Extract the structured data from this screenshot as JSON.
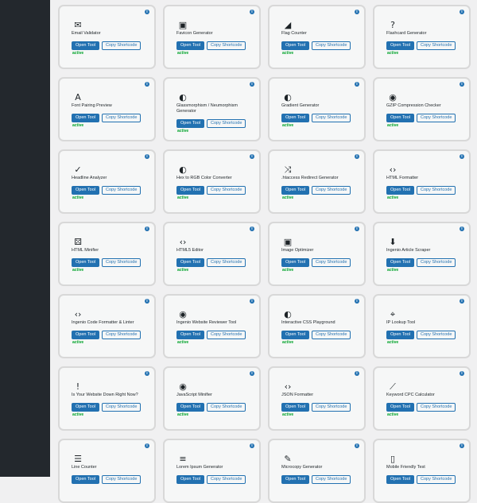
{
  "colors": {
    "sidebar": "#23282d",
    "primary": "#2271b1",
    "active": "#00a32a",
    "background": "#f0f0f1"
  },
  "tools": [
    {
      "title": "Email Validator",
      "icon": "envelope-icon",
      "glyph": "✉",
      "status": "active"
    },
    {
      "title": "Favicon Generator",
      "icon": "image-icon",
      "glyph": "▣",
      "status": "active"
    },
    {
      "title": "Flag Counter",
      "icon": "chart-area-icon",
      "glyph": "◢",
      "status": "active"
    },
    {
      "title": "Flashcard Generator",
      "icon": "help-circle-icon",
      "glyph": "?",
      "status": "active"
    },
    {
      "title": "Font Pairing Preview",
      "icon": "font-icon",
      "glyph": "A",
      "status": "active"
    },
    {
      "title": "Glassmorphism / Neumorphism Generator",
      "icon": "palette-icon",
      "glyph": "◐",
      "status": "active"
    },
    {
      "title": "Gradient Generator",
      "icon": "palette-icon",
      "glyph": "◐",
      "status": "active"
    },
    {
      "title": "GZIP Compression Checker",
      "icon": "eye-icon",
      "glyph": "◉",
      "status": "active"
    },
    {
      "title": "Headline Analyzer",
      "icon": "spellcheck-icon",
      "glyph": "✓",
      "status": "active"
    },
    {
      "title": "Hex to RGB Color Converter",
      "icon": "palette-icon",
      "glyph": "◐",
      "status": "active"
    },
    {
      "title": ".htaccess Redirect Generator",
      "icon": "shuffle-icon",
      "glyph": "⤨",
      "status": "active"
    },
    {
      "title": "HTML Formatter",
      "icon": "code-icon",
      "glyph": "‹›",
      "status": "active"
    },
    {
      "title": "HTML Minifier",
      "icon": "dice-icon",
      "glyph": "⚄",
      "status": "active"
    },
    {
      "title": "HTML5 Editor",
      "icon": "code-icon",
      "glyph": "‹›",
      "status": "active"
    },
    {
      "title": "Image Optimizer",
      "icon": "image-icon",
      "glyph": "▣",
      "status": "active"
    },
    {
      "title": "Ingenio Article Scraper",
      "icon": "download-icon",
      "glyph": "⬇",
      "status": "active"
    },
    {
      "title": "Ingenio Code Formatter & Linter",
      "icon": "code-icon",
      "glyph": "‹›",
      "status": "active"
    },
    {
      "title": "Ingenio Website Reviewer Tool",
      "icon": "eye-icon",
      "glyph": "◉",
      "status": "active"
    },
    {
      "title": "Interactive CSS Playground",
      "icon": "palette-icon",
      "glyph": "◐",
      "status": "active"
    },
    {
      "title": "IP Lookup Tool",
      "icon": "location-icon",
      "glyph": "⌖",
      "status": "active"
    },
    {
      "title": "Is Your Website Down Right Now?",
      "icon": "warning-icon",
      "glyph": "!",
      "status": "active"
    },
    {
      "title": "JavaScript Minifier",
      "icon": "eye-icon",
      "glyph": "◉",
      "status": "active"
    },
    {
      "title": "JSON Formatter",
      "icon": "code-icon",
      "glyph": "‹›",
      "status": "active"
    },
    {
      "title": "Keyword CPC Calculator",
      "icon": "chart-line-icon",
      "glyph": "⟋",
      "status": "active"
    },
    {
      "title": "Line Counter",
      "icon": "list-icon",
      "glyph": "☰",
      "status": ""
    },
    {
      "title": "Lorem Ipsum Generator",
      "icon": "align-left-icon",
      "glyph": "≡",
      "status": ""
    },
    {
      "title": "Microcopy Generator",
      "icon": "edit-icon",
      "glyph": "✎",
      "status": ""
    },
    {
      "title": "Mobile Friendly Test",
      "icon": "smartphone-icon",
      "glyph": "▯",
      "status": ""
    }
  ],
  "buttons": {
    "open": "Open Tool",
    "copy": "Copy Shortcode"
  },
  "info_glyph": "i"
}
